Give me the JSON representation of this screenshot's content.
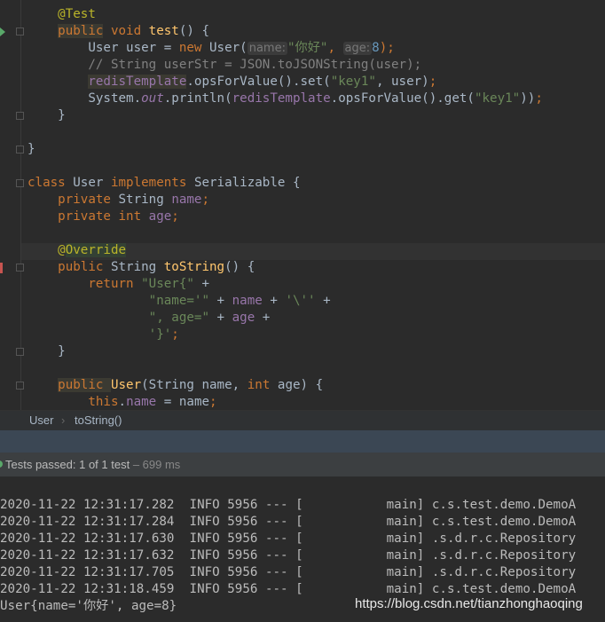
{
  "editor": {
    "lines": [
      [
        [
          "    ",
          "pl"
        ],
        [
          "@Test",
          "ann"
        ]
      ],
      [
        [
          "    ",
          "pl"
        ],
        [
          "public",
          "kw hl"
        ],
        [
          " void ",
          "kw"
        ],
        [
          "test",
          "fn"
        ],
        [
          "() {",
          "pl"
        ]
      ],
      [
        [
          "        User user = ",
          "pl"
        ],
        [
          "new",
          "kw"
        ],
        [
          " User(",
          "pl"
        ],
        [
          "name:",
          "hint"
        ],
        [
          "\"你好\"",
          "str"
        ],
        [
          ", ",
          "kw"
        ],
        [
          "age:",
          "hint"
        ],
        [
          "8",
          "num"
        ],
        [
          ");",
          "kw"
        ]
      ],
      [
        [
          "        // String userStr = JSON.toJSONString(user);",
          "cm"
        ]
      ],
      [
        [
          "        ",
          "pl"
        ],
        [
          "redisTemplate",
          "fld hl"
        ],
        [
          ".opsForValue().set(",
          "pl"
        ],
        [
          "\"key1\"",
          "str"
        ],
        [
          ", user)",
          "pl"
        ],
        [
          ";",
          "kw"
        ]
      ],
      [
        [
          "        System.",
          "pl"
        ],
        [
          "out",
          "st"
        ],
        [
          ".println(",
          "pl"
        ],
        [
          "redisTemplate",
          "fld"
        ],
        [
          ".opsForValue().get(",
          "pl"
        ],
        [
          "\"key1\"",
          "str"
        ],
        [
          "))",
          "pl"
        ],
        [
          ";",
          "kw"
        ]
      ],
      [
        [
          "    }",
          "pl"
        ]
      ],
      [],
      [
        [
          "}",
          "pl"
        ]
      ],
      [],
      [
        [
          "class ",
          "kw"
        ],
        [
          "User ",
          "pl"
        ],
        [
          "implements ",
          "kw"
        ],
        [
          "Serializable {",
          "pl"
        ]
      ],
      [
        [
          "    ",
          "pl"
        ],
        [
          "private ",
          "kw"
        ],
        [
          "String ",
          "pl"
        ],
        [
          "name",
          "fld"
        ],
        [
          ";",
          "kw"
        ]
      ],
      [
        [
          "    ",
          "pl"
        ],
        [
          "private int ",
          "kw"
        ],
        [
          "age",
          "fld"
        ],
        [
          ";",
          "kw"
        ]
      ],
      [],
      [
        [
          "    ",
          "pl"
        ],
        [
          "@",
          "ann"
        ],
        [
          "Override",
          "ann hl2"
        ]
      ],
      [
        [
          "    ",
          "pl"
        ],
        [
          "public ",
          "kw"
        ],
        [
          "String ",
          "pl"
        ],
        [
          "toString",
          "fn"
        ],
        [
          "() {",
          "pl"
        ]
      ],
      [
        [
          "        ",
          "pl"
        ],
        [
          "return ",
          "kw"
        ],
        [
          "\"User{\"",
          "str"
        ],
        [
          " +",
          "pl"
        ]
      ],
      [
        [
          "                ",
          "pl"
        ],
        [
          "\"name='\"",
          "str"
        ],
        [
          " + ",
          "pl"
        ],
        [
          "name",
          "fld"
        ],
        [
          " + ",
          "pl"
        ],
        [
          "'\\''",
          "str"
        ],
        [
          " +",
          "pl"
        ]
      ],
      [
        [
          "                ",
          "pl"
        ],
        [
          "\", age=\"",
          "str"
        ],
        [
          " + ",
          "pl"
        ],
        [
          "age",
          "fld"
        ],
        [
          " +",
          "pl"
        ]
      ],
      [
        [
          "                ",
          "pl"
        ],
        [
          "'}'",
          "str"
        ],
        [
          ";",
          "kw"
        ]
      ],
      [
        [
          "    }",
          "pl"
        ]
      ],
      [],
      [
        [
          "    ",
          "pl"
        ],
        [
          "public ",
          "kw hl"
        ],
        [
          "User",
          "fn"
        ],
        [
          "(String name, ",
          "pl"
        ],
        [
          "int ",
          "kw"
        ],
        [
          "age) {",
          "pl"
        ]
      ],
      [
        [
          "        ",
          "pl"
        ],
        [
          "this",
          "kw"
        ],
        [
          ".",
          "pl"
        ],
        [
          "name",
          "fld"
        ],
        [
          " = name",
          "pl"
        ],
        [
          ";",
          "kw"
        ]
      ]
    ]
  },
  "breadcrumb": {
    "class": "User",
    "separator": "›",
    "method": "toString()"
  },
  "status": {
    "prefix": "Tests passed: ",
    "count": "1",
    "middle": " of 1 test",
    "duration": " – 699 ms"
  },
  "console": {
    "lines": [
      "2020-11-22 12:31:17.282  INFO 5956 --- [           main] c.s.test.demo.DemoA",
      "2020-11-22 12:31:17.284  INFO 5956 --- [           main] c.s.test.demo.DemoA",
      "2020-11-22 12:31:17.630  INFO 5956 --- [           main] .s.d.r.c.Repository",
      "2020-11-22 12:31:17.632  INFO 5956 --- [           main] .s.d.r.c.Repository",
      "2020-11-22 12:31:17.705  INFO 5956 --- [           main] .s.d.r.c.Repository",
      "2020-11-22 12:31:18.459  INFO 5956 --- [           main] c.s.test.demo.DemoA",
      "User{name='你好', age=8}"
    ]
  },
  "watermark": "https://blog.csdn.net/tianzhonghaoqing",
  "colors": {
    "keyword": "#cc7832",
    "string": "#6a8759",
    "field": "#9876aa",
    "method": "#ffc66d",
    "pass": "#59a869"
  }
}
